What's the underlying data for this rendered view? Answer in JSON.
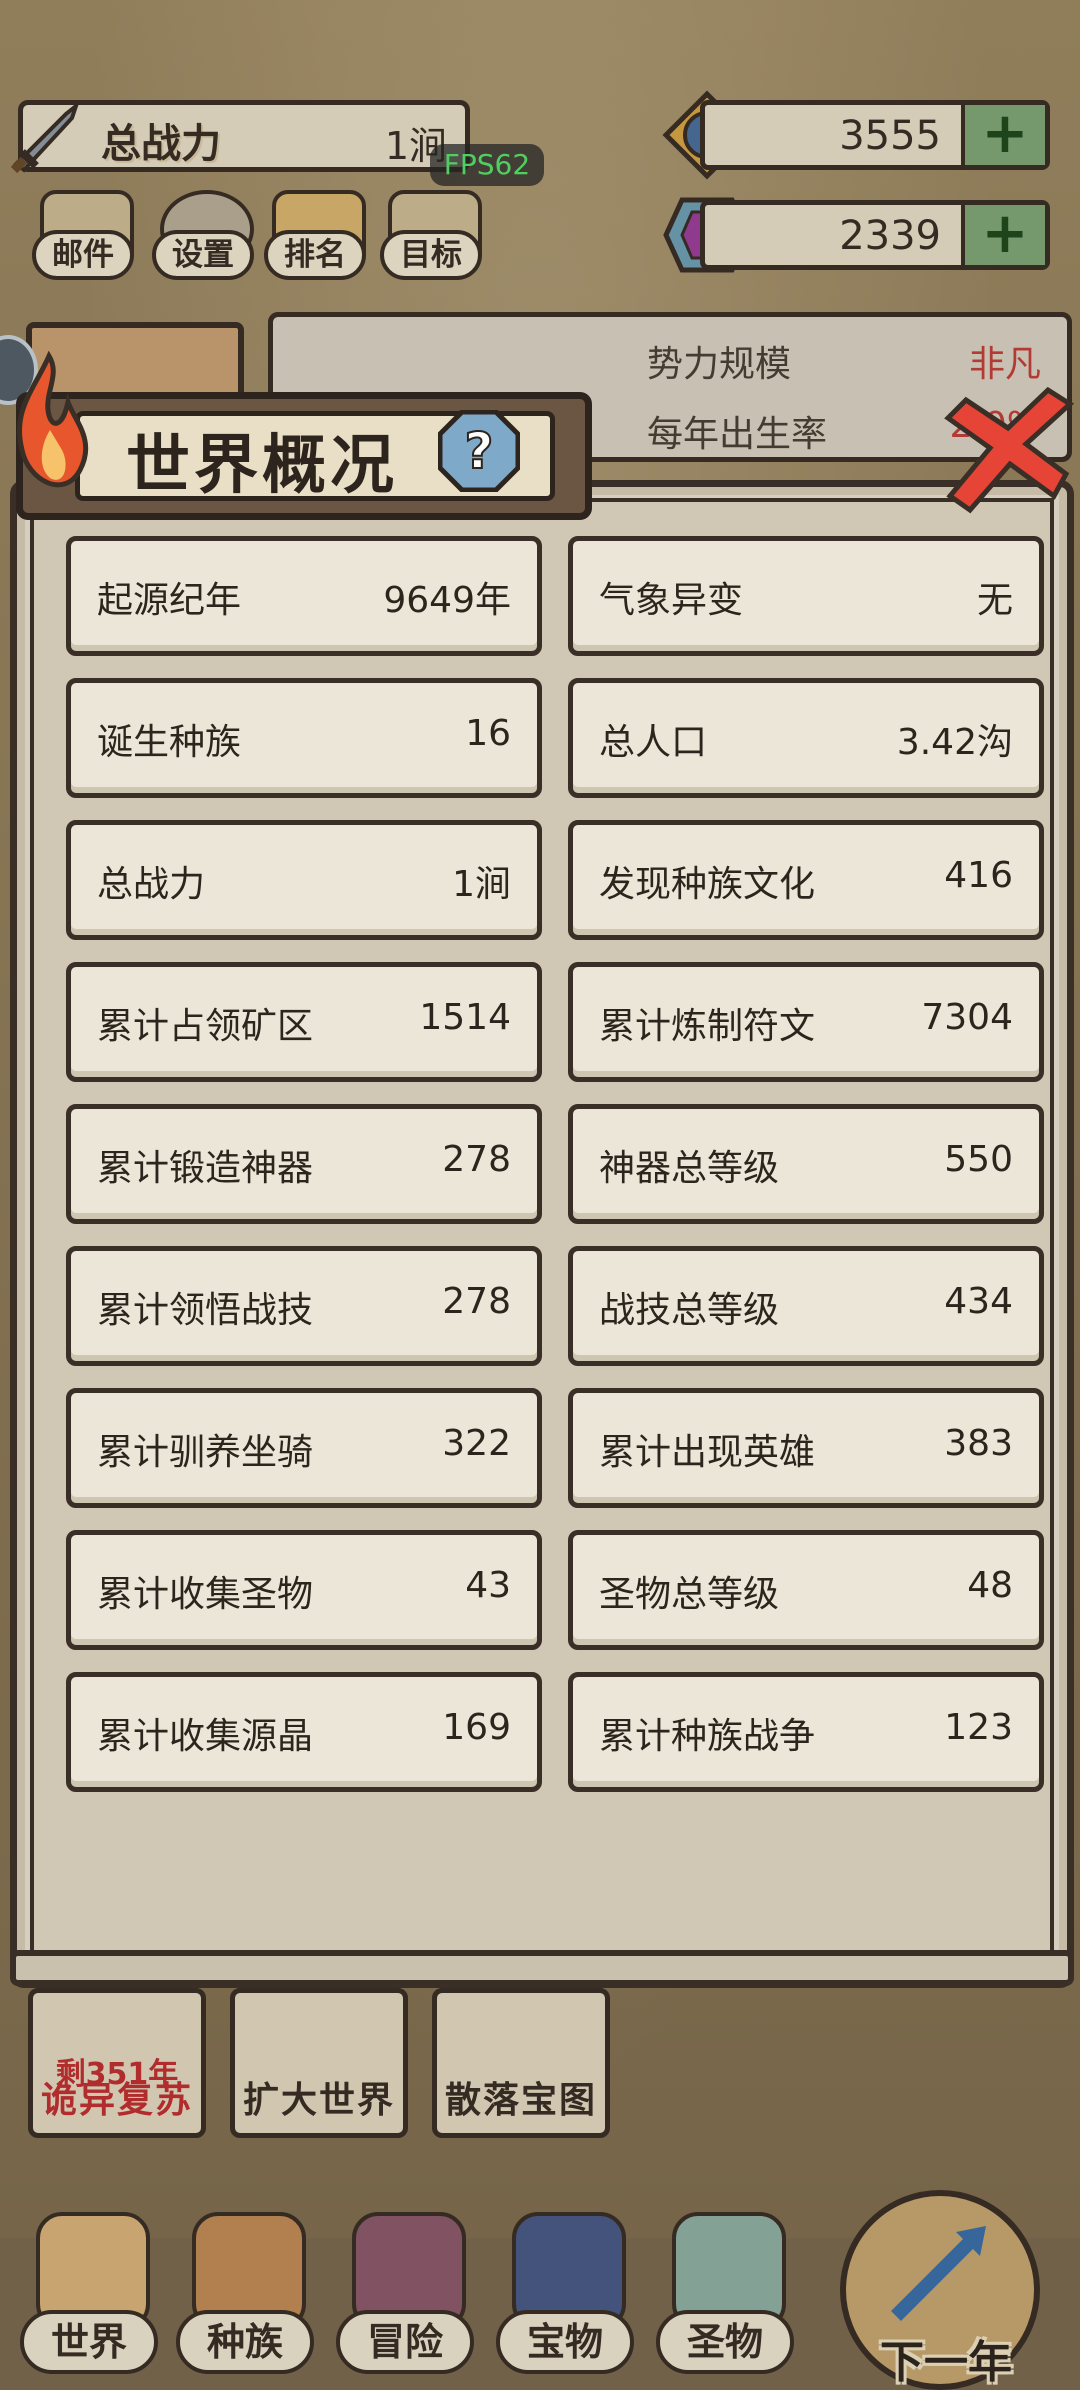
{
  "header": {
    "power_label": "总战力",
    "power_value": "1涧",
    "fps": "FPS62",
    "currency1_value": "3555",
    "currency2_value": "2339",
    "plus_label": "+",
    "buttons": [
      "邮件",
      "设置",
      "排名",
      "目标"
    ]
  },
  "background_panel": {
    "rows": [
      {
        "label": "势力规模",
        "value": "非凡"
      },
      {
        "label": "每年出生率",
        "value": "2.0%"
      }
    ]
  },
  "modal": {
    "title": "世界概况",
    "help_glyph": "?",
    "stats": [
      {
        "label": "起源纪年",
        "value": "9649年"
      },
      {
        "label": "气象异变",
        "value": "无"
      },
      {
        "label": "诞生种族",
        "value": "16"
      },
      {
        "label": "总人口",
        "value": "3.42沟"
      },
      {
        "label": "总战力",
        "value": "1涧"
      },
      {
        "label": "发现种族文化",
        "value": "416"
      },
      {
        "label": "累计占领矿区",
        "value": "1514"
      },
      {
        "label": "累计炼制符文",
        "value": "7304"
      },
      {
        "label": "累计锻造神器",
        "value": "278"
      },
      {
        "label": "神器总等级",
        "value": "550"
      },
      {
        "label": "累计领悟战技",
        "value": "278"
      },
      {
        "label": "战技总等级",
        "value": "434"
      },
      {
        "label": "累计驯养坐骑",
        "value": "322"
      },
      {
        "label": "累计出现英雄",
        "value": "383"
      },
      {
        "label": "累计收集圣物",
        "value": "43"
      },
      {
        "label": "圣物总等级",
        "value": "48"
      },
      {
        "label": "累计收集源晶",
        "value": "169"
      },
      {
        "label": "累计种族战争",
        "value": "123"
      }
    ]
  },
  "events": [
    {
      "sub": "剩351年",
      "label": "诡异复苏"
    },
    {
      "sub": "",
      "label": "扩大世界"
    },
    {
      "sub": "",
      "label": "散落宝图"
    }
  ],
  "nav": [
    "世界",
    "种族",
    "冒险",
    "宝物",
    "圣物"
  ],
  "next_label": "下一年",
  "colors": {
    "accent_red": "#c2423a",
    "panel": "#d6cfbf",
    "outline": "#3a2f26"
  }
}
